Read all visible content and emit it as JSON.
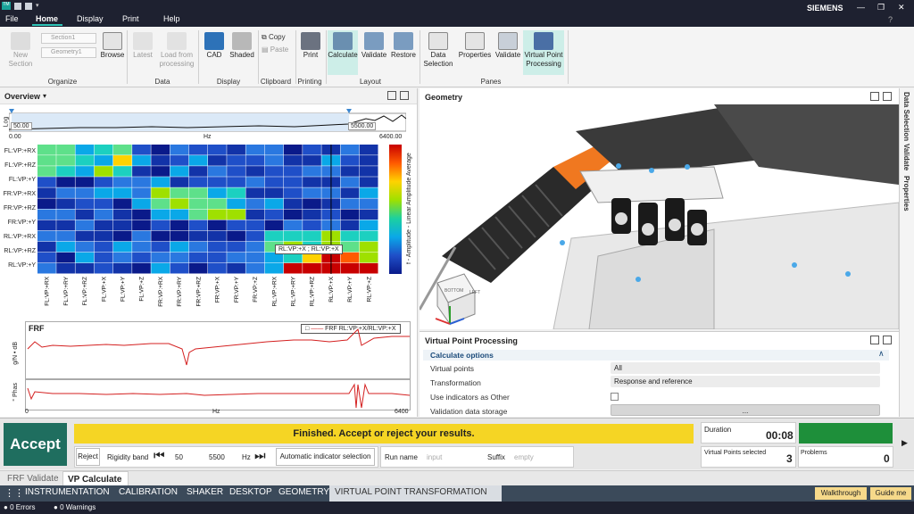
{
  "titlebar": {
    "brand": "SIEMENS",
    "help": "?",
    "minimize": "—",
    "restore": "❐",
    "close": "✕"
  },
  "menu": {
    "file": "File",
    "home": "Home",
    "display": "Display",
    "print": "Print",
    "help": "Help"
  },
  "ribbon": {
    "new_section": "New Section",
    "section_dropdown": "Section1",
    "geometry_dropdown": "Geometry1",
    "browse": "Browse",
    "latest": "Latest",
    "load_from_processing": "Load from processing",
    "cad": "CAD",
    "shaded": "Shaded",
    "copy": "Copy",
    "paste": "Paste",
    "print": "Print",
    "calculate": "Calculate",
    "validate": "Validate",
    "restore": "Restore",
    "data_selection": "Data Selection",
    "properties": "Properties",
    "validate2": "Validate",
    "vpp": "Virtual Point Processing",
    "groups": {
      "organize": "Organize",
      "data": "Data",
      "display": "Display",
      "clipboard": "Clipboard",
      "printing": "Printing",
      "layout": "Layout",
      "panes": "Panes"
    }
  },
  "overview": {
    "title": "Overview",
    "slider_left": "50.00",
    "slider_right": "5500.00",
    "axis_min": "0.00",
    "axis_unit": "Hz",
    "axis_max": "6400.00",
    "log_label": "Log",
    "rows": [
      "FL:VP:+RX",
      "FL:VP:+RZ",
      "FL:VP:+Y",
      "FR:VP:+RX",
      "FR:VP:+RZ",
      "FR:VP:+Y",
      "RL:VP:+RX",
      "RL:VP:+RZ",
      "RL:VP:+Y"
    ],
    "cols": [
      "FL:VP:+RX",
      "FL:VP:+RY",
      "FL:VP:+RZ",
      "FL:VP:+X",
      "FL:VP:+Y",
      "FL:VP:+Z",
      "FR:VP:+RX",
      "FR:VP:+RY",
      "FR:VP:+RZ",
      "FR:VP:+X",
      "FR:VP:+Y",
      "FR:VP:+Z",
      "RL:VP:+RX",
      "RL:VP:+RY",
      "RL:VP:+RZ",
      "RL:VP:+X",
      "RL:VP:+Y",
      "RL:VP:+Z"
    ],
    "tooltip": "RL:VP:+X ; RL:VP:+X",
    "colorbar_label": "f - Amplitude - Linear Amplitude Average"
  },
  "frf": {
    "title": "FRF",
    "legend": "FRF RL:VP:+X/RL:VP:+X",
    "ylabel1": "g/N • dB",
    "ylabel2": "° Phas",
    "x_min": "0",
    "x_unit": "Hz",
    "x_max": "6400"
  },
  "geometry": {
    "title": "Geometry",
    "cube_bottom": "BOTTOM",
    "cube_left": "LEFT"
  },
  "vpp": {
    "title": "Virtual Point Processing",
    "section": "Calculate options",
    "rows": [
      {
        "label": "Virtual points",
        "value": "All"
      },
      {
        "label": "Transformation",
        "value": "Response and reference"
      },
      {
        "label": "Use indicators as Other",
        "value": ""
      },
      {
        "label": "Validation data storage",
        "value": "..."
      }
    ]
  },
  "sidetabs": {
    "data_selection": "Data Selection",
    "validate": "Validate",
    "properties": "Properties"
  },
  "bottom": {
    "accept": "Accept",
    "message": "Finished. Accept or reject your results.",
    "reject": "Reject",
    "rigidity_band": "Rigidity band",
    "band_low": "50",
    "band_high": "5500",
    "band_unit": "Hz",
    "auto_indicator": "Automatic indicator selection",
    "run_name": "Run name",
    "run_placeholder": "input",
    "suffix": "Suffix",
    "suffix_placeholder": "empty",
    "duration_label": "Duration",
    "duration": "00:08",
    "vp_selected_label": "Virtual Points selected",
    "vp_selected": "3",
    "problems_label": "Problems",
    "problems": "0",
    "accent": "#1f6e5f",
    "status_green": "#1e8f3a",
    "banner_yellow": "#f5d524"
  },
  "tabs1": [
    "FRF Validate",
    "VP Calculate"
  ],
  "tabs2": [
    "INSTRUMENTATION",
    "CALIBRATION",
    "SHAKER",
    "DESKTOP",
    "GEOMETRY",
    "VIRTUAL POINT TRANSFORMATION"
  ],
  "tabs2_right": {
    "walkthrough": "Walkthrough",
    "guide": "Guide me"
  },
  "status": {
    "errors": "0 Errors",
    "warnings": "0 Warnings"
  }
}
